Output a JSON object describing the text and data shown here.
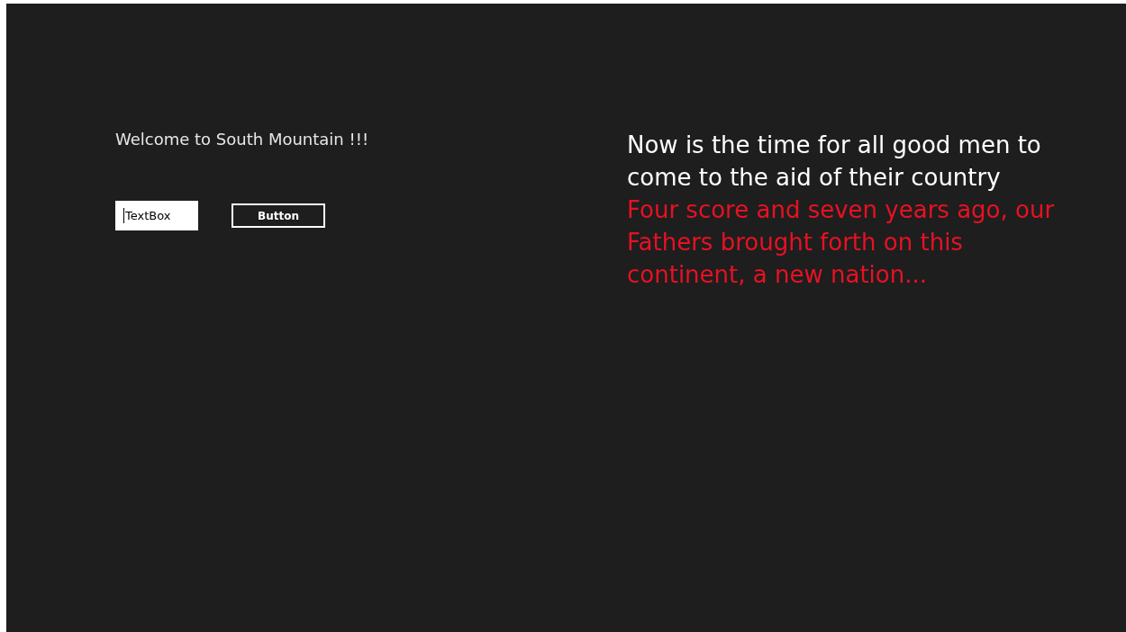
{
  "greeting": "Welcome to South Mountain !!!",
  "text_box": {
    "value": "TextBox",
    "focused": true
  },
  "button": {
    "label": "Button"
  },
  "paragraphs": [
    {
      "text": "Now is the time for all good men to come to the aid of their country",
      "color": "#ffffff"
    },
    {
      "text": "Four score and seven years ago, our Fathers brought forth on this continent, a new nation...",
      "color": "#e81123"
    }
  ]
}
